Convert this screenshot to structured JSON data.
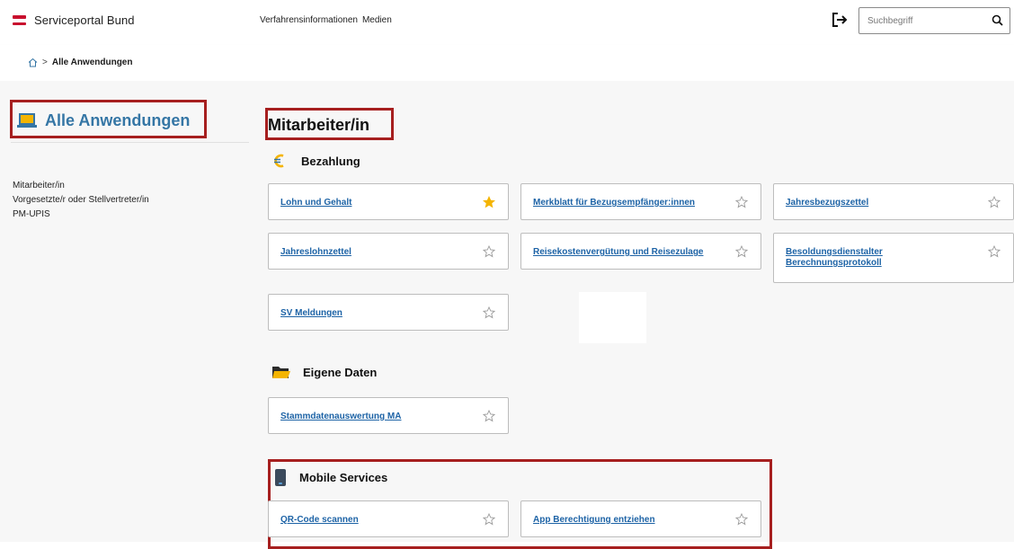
{
  "header": {
    "logo_text": "Serviceportal Bund",
    "nav": [
      "Verfahrensinformationen",
      "Medien"
    ],
    "search_placeholder": "Suchbegriff",
    "accent_color": "#c8102e"
  },
  "breadcrumb": {
    "current": "Alle Anwendungen"
  },
  "sidebar": {
    "title": "Alle Anwendungen",
    "items": [
      "Mitarbeiter/in",
      "Vorgesetzte/r oder Stellvertreter/in",
      "PM-UPIS"
    ]
  },
  "main": {
    "title": "Mitarbeiter/in",
    "sections": [
      {
        "title": "Bezahlung",
        "icon": "euro-icon",
        "cards": [
          {
            "label": "Lohn und Gehalt",
            "favorite": true
          },
          {
            "label": "Merkblatt für Bezugsempfänger:innen",
            "favorite": false
          },
          {
            "label": "Jahresbezugszettel",
            "favorite": false
          },
          {
            "label": "Jahreslohnzettel",
            "favorite": false
          },
          {
            "label": "Reisekostenvergütung und Reisezulage",
            "favorite": false
          },
          {
            "label": "Besoldungsdienstalter Berechnungsprotokoll",
            "favorite": false
          },
          {
            "label": "SV Meldungen",
            "favorite": false
          }
        ]
      },
      {
        "title": "Eigene Daten",
        "icon": "folder-icon",
        "cards": [
          {
            "label": "Stammdatenauswertung MA",
            "favorite": false
          }
        ]
      },
      {
        "title": "Mobile Services",
        "icon": "mobile-phone-icon",
        "cards": [
          {
            "label": "QR-Code scannen",
            "favorite": false
          },
          {
            "label": "App Berechtigung entziehen",
            "favorite": false
          }
        ]
      }
    ]
  },
  "colors": {
    "link": "#1d63a6",
    "sidebar_title": "#3576a5",
    "highlight_box": "#a61f1f",
    "star_active": "#f4b400"
  }
}
